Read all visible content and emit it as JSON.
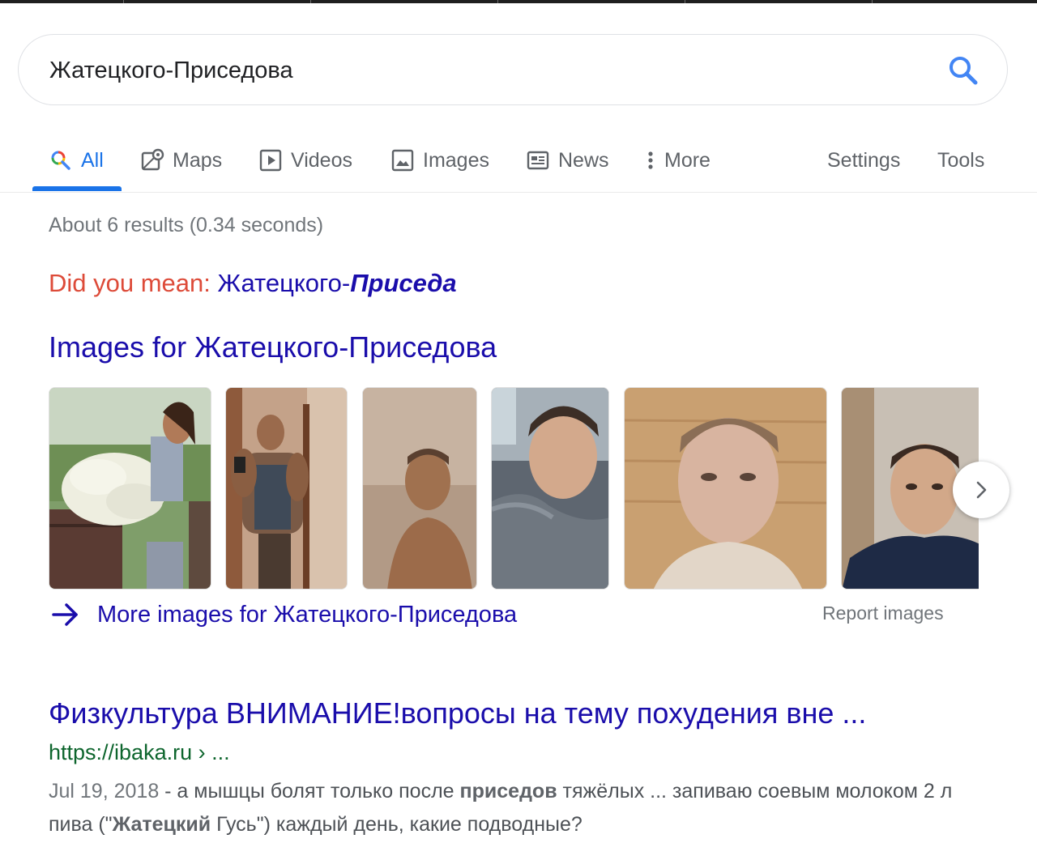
{
  "search": {
    "query": "Жатецкого-Приседова"
  },
  "tabs": {
    "all": "All",
    "maps": "Maps",
    "videos": "Videos",
    "images": "Images",
    "news": "News",
    "more": "More",
    "settings": "Settings",
    "tools": "Tools"
  },
  "stats": "About 6 results (0.34 seconds)",
  "did_you_mean": {
    "label": "Did you mean:",
    "plain": "Жатецкого-",
    "emphasis": "Приседа"
  },
  "images_section": {
    "heading": "Images for Жатецкого-Приседова",
    "more_link": "More images for Жатецкого-Приседова",
    "report": "Report images"
  },
  "result": {
    "title": "Физкультура ВНИМАНИЕ!вопросы на тему похудения вне ...",
    "url": "https://ibaka.ru › ...",
    "date": "Jul 19, 2018",
    "snippet_parts": [
      " - а мышцы болят только после ",
      "приседов",
      " тяжёлых ... запиваю соевым молоком 2 л пива (\"",
      "Жатецкий",
      " Гусь\") каждый день, какие подводные?"
    ]
  },
  "colors": {
    "link": "#1a0dab",
    "accent": "#1a73e8",
    "url_green": "#0d652d",
    "did_you_mean_red": "#dd4b39"
  }
}
